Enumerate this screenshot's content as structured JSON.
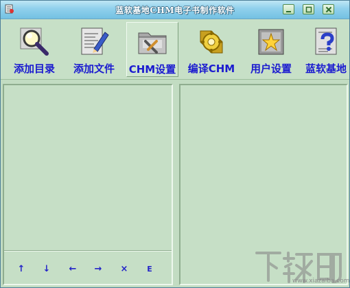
{
  "window": {
    "title": "蓝软基地CHM电子书制作软件"
  },
  "toolbar": {
    "items": [
      {
        "label": "添加目录",
        "icon": "magnifier-icon"
      },
      {
        "label": "添加文件",
        "icon": "edit-document-icon"
      },
      {
        "label": "CHM设置",
        "icon": "folder-tools-icon",
        "active": true
      },
      {
        "label": "编译CHM",
        "icon": "gear-compile-icon"
      },
      {
        "label": "用户设置",
        "icon": "star-settings-icon"
      },
      {
        "label": "蓝软基地",
        "icon": "help-document-icon"
      }
    ]
  },
  "tree_controls": {
    "up": "↑",
    "down": "↓",
    "left": "←",
    "right": "→",
    "delete": "×",
    "edit": "E"
  },
  "watermark": {
    "brand": "下载吧",
    "url": "www.xiazaiba.com"
  },
  "colors": {
    "title_gradient": "#8fd0ec",
    "label_blue": "#1b1bd0",
    "panel_green": "#c6dfc6"
  }
}
